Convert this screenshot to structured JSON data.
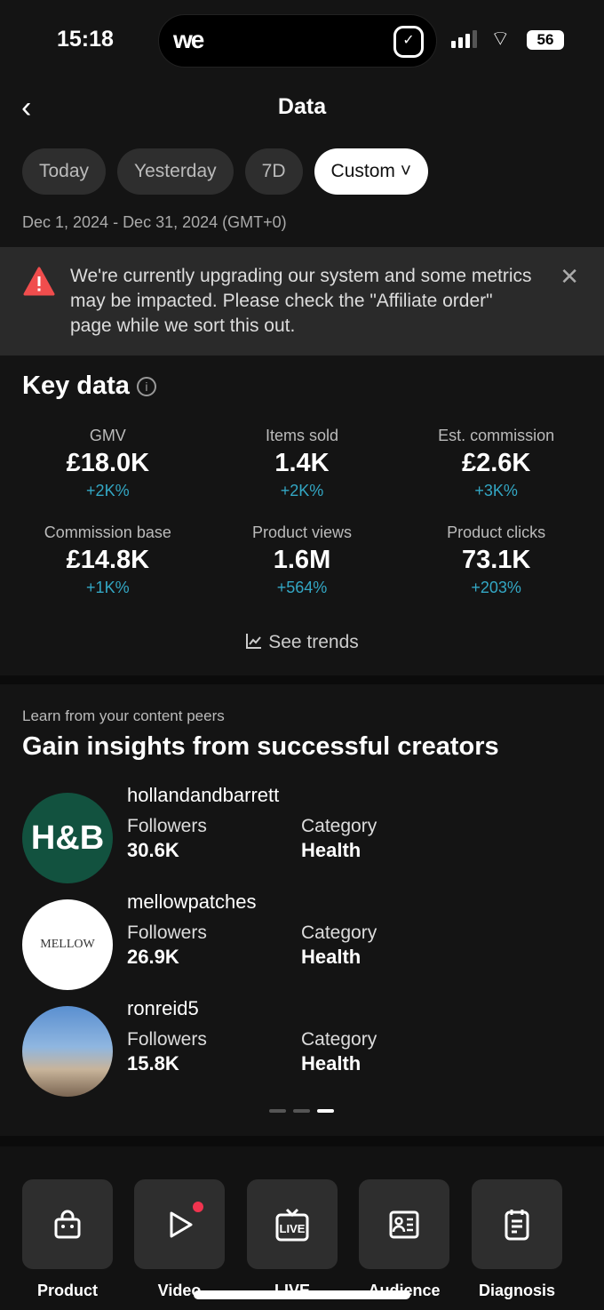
{
  "status": {
    "time": "15:18",
    "app_badge": "we",
    "battery": "56"
  },
  "header": {
    "title": "Data"
  },
  "chips": [
    {
      "label": "Today"
    },
    {
      "label": "Yesterday"
    },
    {
      "label": "7D"
    },
    {
      "label": "Custom ˅",
      "selected": true
    }
  ],
  "date_range": "Dec 1, 2024 - Dec 31, 2024 (GMT+0)",
  "banner": {
    "text": "We're currently upgrading our system and some metrics may be impacted. Please check the \"Affiliate order\" page while we sort this out.",
    "icon": "warning-icon",
    "close": "✕"
  },
  "key_data": {
    "title": "Key data",
    "info": "i",
    "metrics": [
      {
        "label": "GMV",
        "value": "£18.0K",
        "change": "+2K%"
      },
      {
        "label": "Items sold",
        "value": "1.4K",
        "change": "+2K%"
      },
      {
        "label": "Est. commission",
        "value": "£2.6K",
        "change": "+3K%"
      },
      {
        "label": "Commission base",
        "value": "£14.8K",
        "change": "+1K%"
      },
      {
        "label": "Product views",
        "value": "1.6M",
        "change": "+564%"
      },
      {
        "label": "Product clicks",
        "value": "73.1K",
        "change": "+203%"
      }
    ],
    "see_trends": "See trends"
  },
  "peers": {
    "subtitle": "Learn from your content peers",
    "title": "Gain insights from successful creators",
    "followers_label": "Followers",
    "category_label": "Category",
    "creators": [
      {
        "name": "hollandandbarrett",
        "followers": "30.6K",
        "category": "Health",
        "logo": "H&B"
      },
      {
        "name": "mellowpatches",
        "followers": "26.9K",
        "category": "Health",
        "logo": "MELLOW"
      },
      {
        "name": "ronreid5",
        "followers": "15.8K",
        "category": "Health"
      }
    ],
    "page": 3,
    "pages": 3
  },
  "nav": [
    {
      "label": "Product"
    },
    {
      "label": "Video"
    },
    {
      "label": "LIVE"
    },
    {
      "label": "Audience"
    },
    {
      "label": "Diagnosis"
    }
  ],
  "colors": {
    "accent_change": "#33a7c4",
    "warning": "#f04d4d",
    "notification": "#f0344f"
  }
}
